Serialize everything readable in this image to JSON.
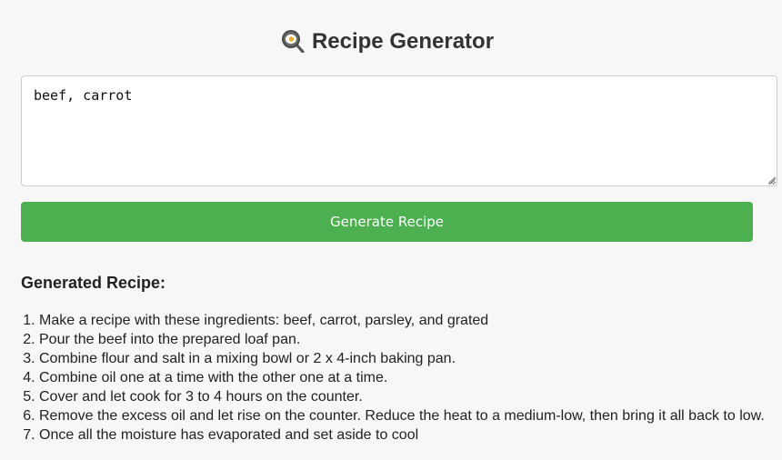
{
  "header": {
    "icon": "frying-pan-egg-icon",
    "title": "Recipe Generator"
  },
  "input": {
    "value": "beef, carrot"
  },
  "actions": {
    "generate_label": "Generate Recipe",
    "accent_color": "#4caf50"
  },
  "result": {
    "heading": "Generated Recipe:",
    "steps": [
      "Make a recipe with these ingredients: beef, carrot, parsley, and grated",
      "Pour the beef into the prepared loaf pan.",
      "Combine flour and salt in a mixing bowl or 2 x 4-inch baking pan.",
      "Combine oil one at a time with the other one at a time.",
      "Cover and let cook for 3 to 4 hours on the counter.",
      "Remove the excess oil and let rise on the counter. Reduce the heat to a medium-low, then bring it all back to low.",
      "Once all the moisture has evaporated and set aside to cool"
    ]
  }
}
